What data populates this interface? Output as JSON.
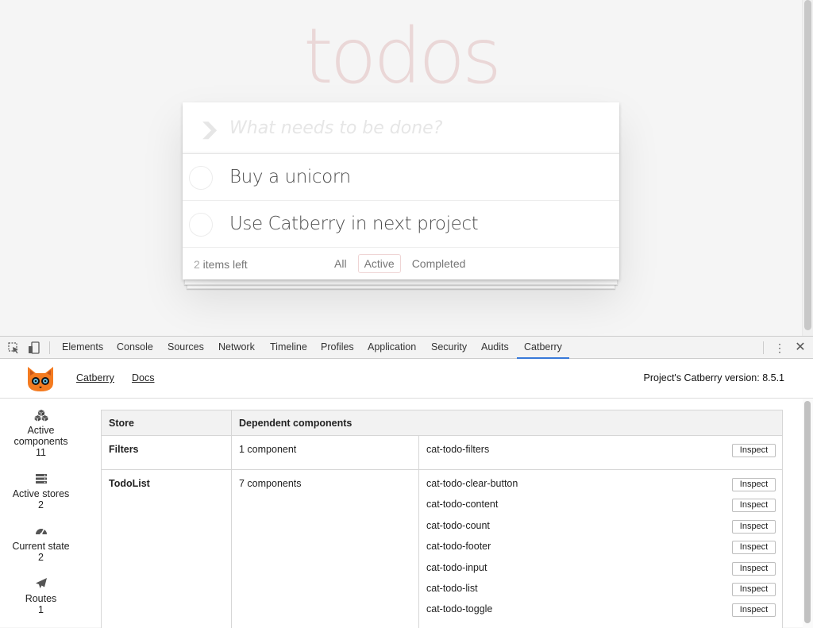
{
  "app": {
    "title": "todos",
    "new_todo_placeholder": "What needs to be done?",
    "todos": [
      {
        "label": "Buy a unicorn",
        "completed": false
      },
      {
        "label": "Use Catberry in next project",
        "completed": false
      }
    ],
    "footer": {
      "count": "2",
      "count_suffix": " items left",
      "filters": [
        "All",
        "Active",
        "Completed"
      ],
      "selected_filter": "Active"
    },
    "accent_color": "#af2f2f"
  },
  "devtools": {
    "tabs": [
      "Elements",
      "Console",
      "Sources",
      "Network",
      "Timeline",
      "Profiles",
      "Application",
      "Security",
      "Audits",
      "Catberry"
    ],
    "active_tab": "Catberry",
    "icons": [
      "inspect-element-icon",
      "device-toolbar-icon",
      "more-options-icon",
      "close-icon"
    ],
    "active_color": "#3879d9"
  },
  "catberry": {
    "links": [
      "Catberry",
      "Docs"
    ],
    "version_text": "Project's Catberry version: 8.5.1",
    "sidebar": [
      {
        "icon": "components-icon",
        "label": "Active components",
        "count": "11"
      },
      {
        "icon": "stores-icon",
        "label": "Active stores",
        "count": "2"
      },
      {
        "icon": "dashboard-icon",
        "label": "Current state",
        "count": "2"
      },
      {
        "icon": "paper-plane-icon",
        "label": "Routes",
        "count": "1"
      }
    ],
    "table": {
      "headers": [
        "Store",
        "Dependent components"
      ],
      "inspect_label": "Inspect",
      "rows": [
        {
          "store": "Filters",
          "count": "1 component",
          "components": [
            "cat-todo-filters"
          ]
        },
        {
          "store": "TodoList",
          "count": "7 components",
          "components": [
            "cat-todo-clear-button",
            "cat-todo-content",
            "cat-todo-count",
            "cat-todo-footer",
            "cat-todo-input",
            "cat-todo-list",
            "cat-todo-toggle"
          ]
        }
      ]
    }
  }
}
